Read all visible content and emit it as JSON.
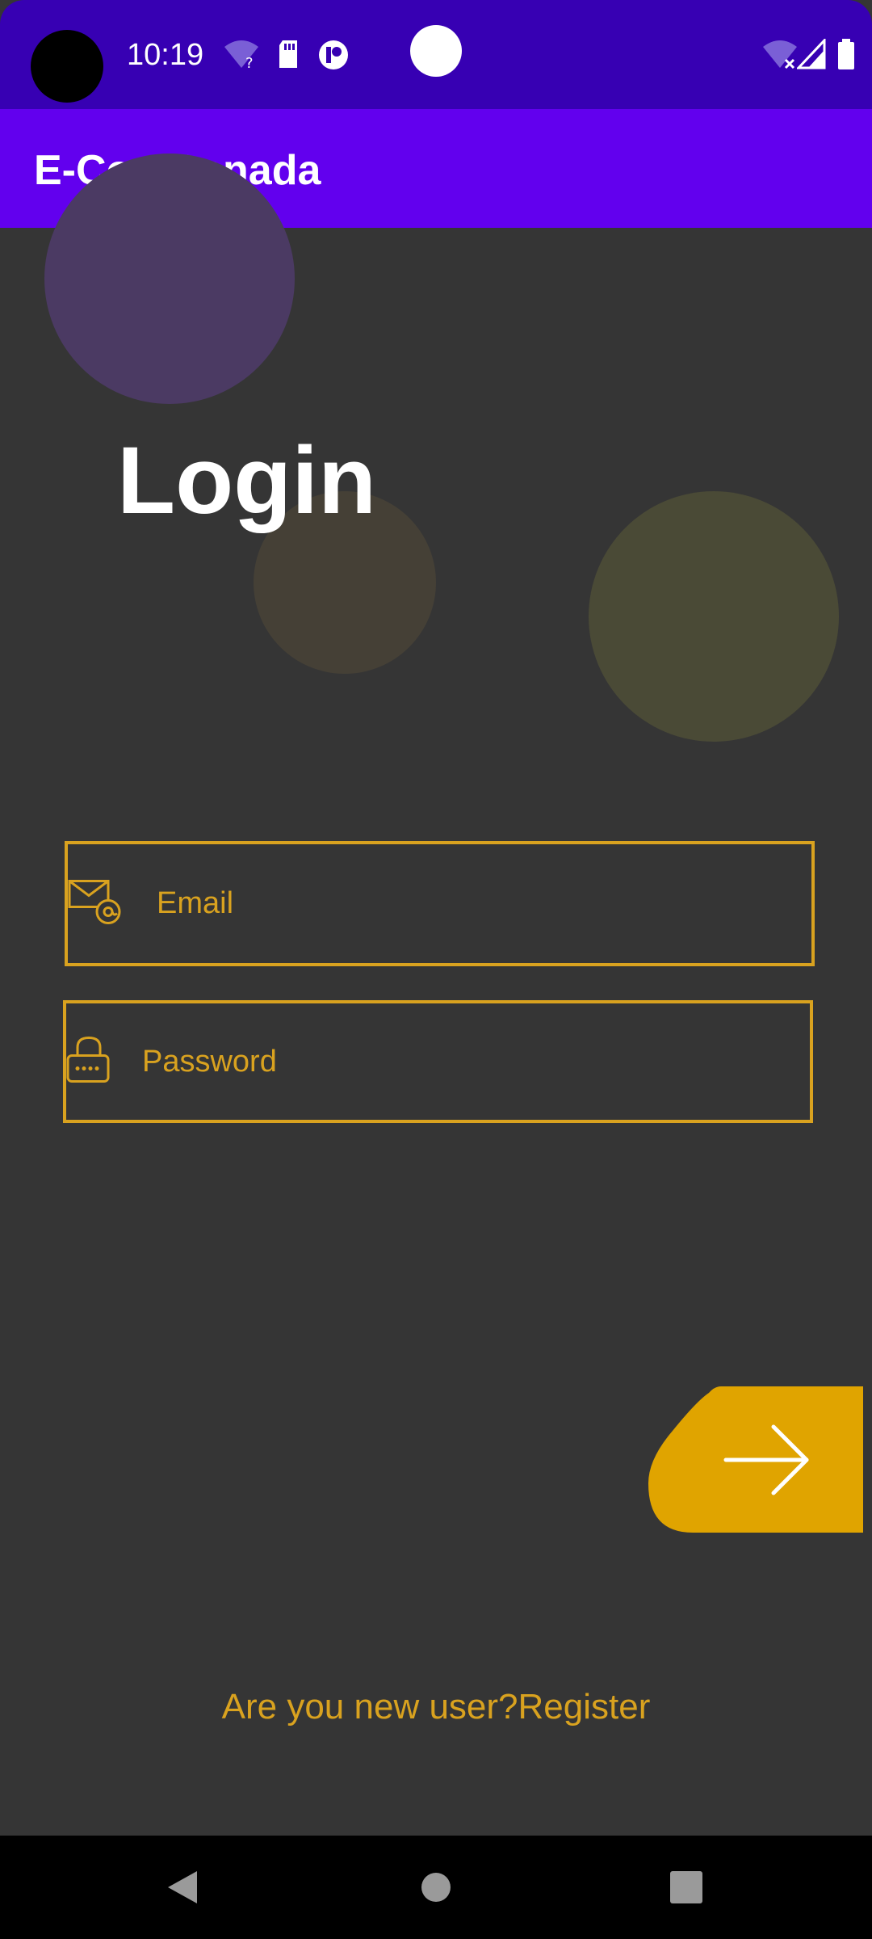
{
  "status_bar": {
    "time": "10:19",
    "icons": [
      "wifi-unknown-icon",
      "sd-card-icon",
      "app-notification-icon",
      "wifi-off-icon",
      "signal-icon",
      "battery-icon"
    ]
  },
  "app_bar": {
    "title": "E-ComCanada"
  },
  "login": {
    "title": "Login",
    "email_placeholder": "Email",
    "password_placeholder": "Password",
    "register_text": "Are you new user?Register"
  },
  "colors": {
    "status_bar": "#3700B3",
    "app_bar": "#6200EE",
    "background": "#353535",
    "accent": "#D9A21F",
    "button": "#E0A400"
  },
  "nav_bar": {
    "buttons": [
      "back-icon",
      "home-icon",
      "recents-icon"
    ]
  }
}
